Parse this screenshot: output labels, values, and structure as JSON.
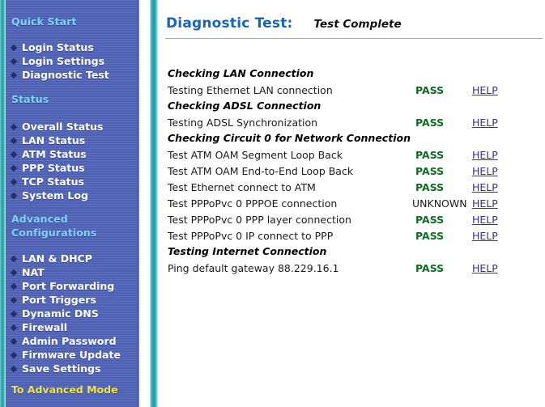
{
  "sidebar": {
    "sections": [
      {
        "heading": "Quick Start",
        "items": [
          {
            "label": "Login Status"
          },
          {
            "label": "Login Settings"
          },
          {
            "label": "Diagnostic Test"
          }
        ]
      },
      {
        "heading": "Status",
        "items": [
          {
            "label": "Overall Status"
          },
          {
            "label": "LAN Status"
          },
          {
            "label": "ATM Status"
          },
          {
            "label": "PPP Status"
          },
          {
            "label": "TCP Status"
          },
          {
            "label": "System Log"
          }
        ]
      },
      {
        "heading": "Advanced Configurations",
        "heading_line1": "Advanced",
        "heading_line2": "Configurations",
        "items": [
          {
            "label": "LAN & DHCP"
          },
          {
            "label": "NAT"
          },
          {
            "label": "Port Forwarding"
          },
          {
            "label": "Port Triggers"
          },
          {
            "label": "Dynamic DNS"
          },
          {
            "label": "Firewall"
          },
          {
            "label": "Admin Password"
          },
          {
            "label": "Firmware Update"
          },
          {
            "label": "Save Settings"
          }
        ]
      }
    ],
    "advanced_mode_link": "To Advanced Mode",
    "colors": {
      "panel": "#4f63b8",
      "heading": "#7fd4f2",
      "item": "#ffffff",
      "bullet": "#242f6b",
      "advanced_mode": "#f5e53a",
      "teal_divider": "#17a2ad"
    }
  },
  "main": {
    "title": "Diagnostic Test:",
    "status": "Test Complete",
    "colors": {
      "title": "#1565c0",
      "pass": "#0f6b22",
      "help_link": "#3d2c8d",
      "rule": "#a6a6a6"
    },
    "status_labels": {
      "pass": "PASS",
      "unknown": "UNKNOWN"
    },
    "help_label": "HELP",
    "rows": [
      {
        "type": "header",
        "label": "Checking LAN Connection"
      },
      {
        "type": "test",
        "label": "Testing Ethernet LAN connection",
        "status": "PASS",
        "help": "HELP"
      },
      {
        "type": "header",
        "label": "Checking ADSL Connection"
      },
      {
        "type": "test",
        "label": "Testing ADSL Synchronization",
        "status": "PASS",
        "help": "HELP"
      },
      {
        "type": "header",
        "label": "Checking Circuit 0 for Network Connection"
      },
      {
        "type": "test",
        "label": "Test ATM OAM Segment Loop Back",
        "status": "PASS",
        "help": "HELP"
      },
      {
        "type": "test",
        "label": "Test ATM OAM End-to-End Loop Back",
        "status": "PASS",
        "help": "HELP"
      },
      {
        "type": "test",
        "label": "Test Ethernet connect to ATM",
        "status": "PASS",
        "help": "HELP"
      },
      {
        "type": "test",
        "label": "Test PPPoPvc 0 PPPOE connection",
        "status": "UNKNOWN",
        "help": "HELP"
      },
      {
        "type": "test",
        "label": "Test PPPoPvc 0 PPP layer connection",
        "status": "PASS",
        "help": "HELP"
      },
      {
        "type": "test",
        "label": "Test PPPoPvc 0 IP connect to PPP",
        "status": "PASS",
        "help": "HELP"
      },
      {
        "type": "header",
        "label": "Testing Internet Connection"
      },
      {
        "type": "test",
        "label": "Ping default gateway 88.229.16.1",
        "status": "PASS",
        "help": "HELP"
      }
    ]
  }
}
